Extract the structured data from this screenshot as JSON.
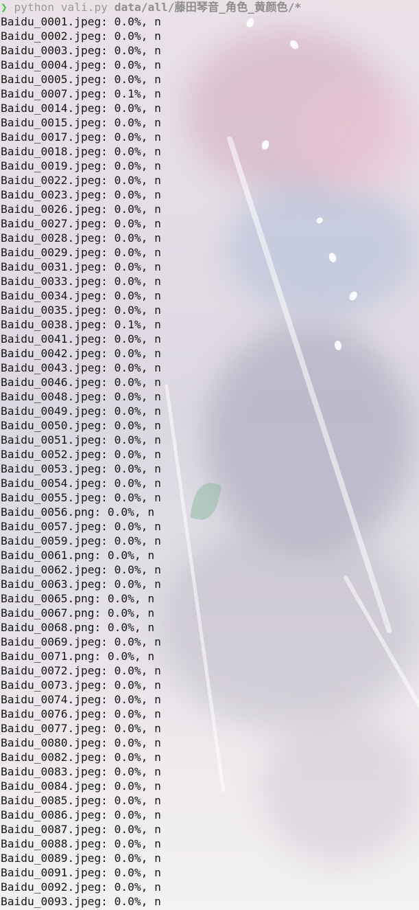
{
  "prompt": {
    "symbol": "❯",
    "program": "python",
    "script": "vali.py",
    "path": "data/all/藤田琴音_角色_黄颜色/*"
  },
  "output_lines": [
    "Baidu_0001.jpeg: 0.0%, n",
    "Baidu_0002.jpeg: 0.0%, n",
    "Baidu_0003.jpeg: 0.0%, n",
    "Baidu_0004.jpeg: 0.0%, n",
    "Baidu_0005.jpeg: 0.0%, n",
    "Baidu_0007.jpeg: 0.1%, n",
    "Baidu_0014.jpeg: 0.0%, n",
    "Baidu_0015.jpeg: 0.0%, n",
    "Baidu_0017.jpeg: 0.0%, n",
    "Baidu_0018.jpeg: 0.0%, n",
    "Baidu_0019.jpeg: 0.0%, n",
    "Baidu_0022.jpeg: 0.0%, n",
    "Baidu_0023.jpeg: 0.0%, n",
    "Baidu_0026.jpeg: 0.0%, n",
    "Baidu_0027.jpeg: 0.0%, n",
    "Baidu_0028.jpeg: 0.0%, n",
    "Baidu_0029.jpeg: 0.0%, n",
    "Baidu_0031.jpeg: 0.0%, n",
    "Baidu_0033.jpeg: 0.0%, n",
    "Baidu_0034.jpeg: 0.0%, n",
    "Baidu_0035.jpeg: 0.0%, n",
    "Baidu_0038.jpeg: 0.1%, n",
    "Baidu_0041.jpeg: 0.0%, n",
    "Baidu_0042.jpeg: 0.0%, n",
    "Baidu_0043.jpeg: 0.0%, n",
    "Baidu_0046.jpeg: 0.0%, n",
    "Baidu_0048.jpeg: 0.0%, n",
    "Baidu_0049.jpeg: 0.0%, n",
    "Baidu_0050.jpeg: 0.0%, n",
    "Baidu_0051.jpeg: 0.0%, n",
    "Baidu_0052.jpeg: 0.0%, n",
    "Baidu_0053.jpeg: 0.0%, n",
    "Baidu_0054.jpeg: 0.0%, n",
    "Baidu_0055.jpeg: 0.0%, n",
    "Baidu_0056.png: 0.0%, n",
    "Baidu_0057.jpeg: 0.0%, n",
    "Baidu_0059.jpeg: 0.0%, n",
    "Baidu_0061.png: 0.0%, n",
    "Baidu_0062.jpeg: 0.0%, n",
    "Baidu_0063.jpeg: 0.0%, n",
    "Baidu_0065.png: 0.0%, n",
    "Baidu_0067.png: 0.0%, n",
    "Baidu_0068.png: 0.0%, n",
    "Baidu_0069.jpeg: 0.0%, n",
    "Baidu_0071.png: 0.0%, n",
    "Baidu_0072.jpeg: 0.0%, n",
    "Baidu_0073.jpeg: 0.0%, n",
    "Baidu_0074.jpeg: 0.0%, n",
    "Baidu_0076.jpeg: 0.0%, n",
    "Baidu_0077.jpeg: 0.0%, n",
    "Baidu_0080.jpeg: 0.0%, n",
    "Baidu_0082.jpeg: 0.0%, n",
    "Baidu_0083.jpeg: 0.0%, n",
    "Baidu_0084.jpeg: 0.0%, n",
    "Baidu_0085.jpeg: 0.0%, n",
    "Baidu_0086.jpeg: 0.0%, n",
    "Baidu_0087.jpeg: 0.0%, n",
    "Baidu_0088.jpeg: 0.0%, n",
    "Baidu_0089.jpeg: 0.0%, n",
    "Baidu_0091.jpeg: 0.0%, n",
    "Baidu_0092.jpeg: 0.0%, n",
    "Baidu_0093.jpeg: 0.0%, n"
  ],
  "colors": {
    "prompt_arrow": "#3fc23f",
    "command_text": "#9a9a9a",
    "output_text": "#141414"
  }
}
